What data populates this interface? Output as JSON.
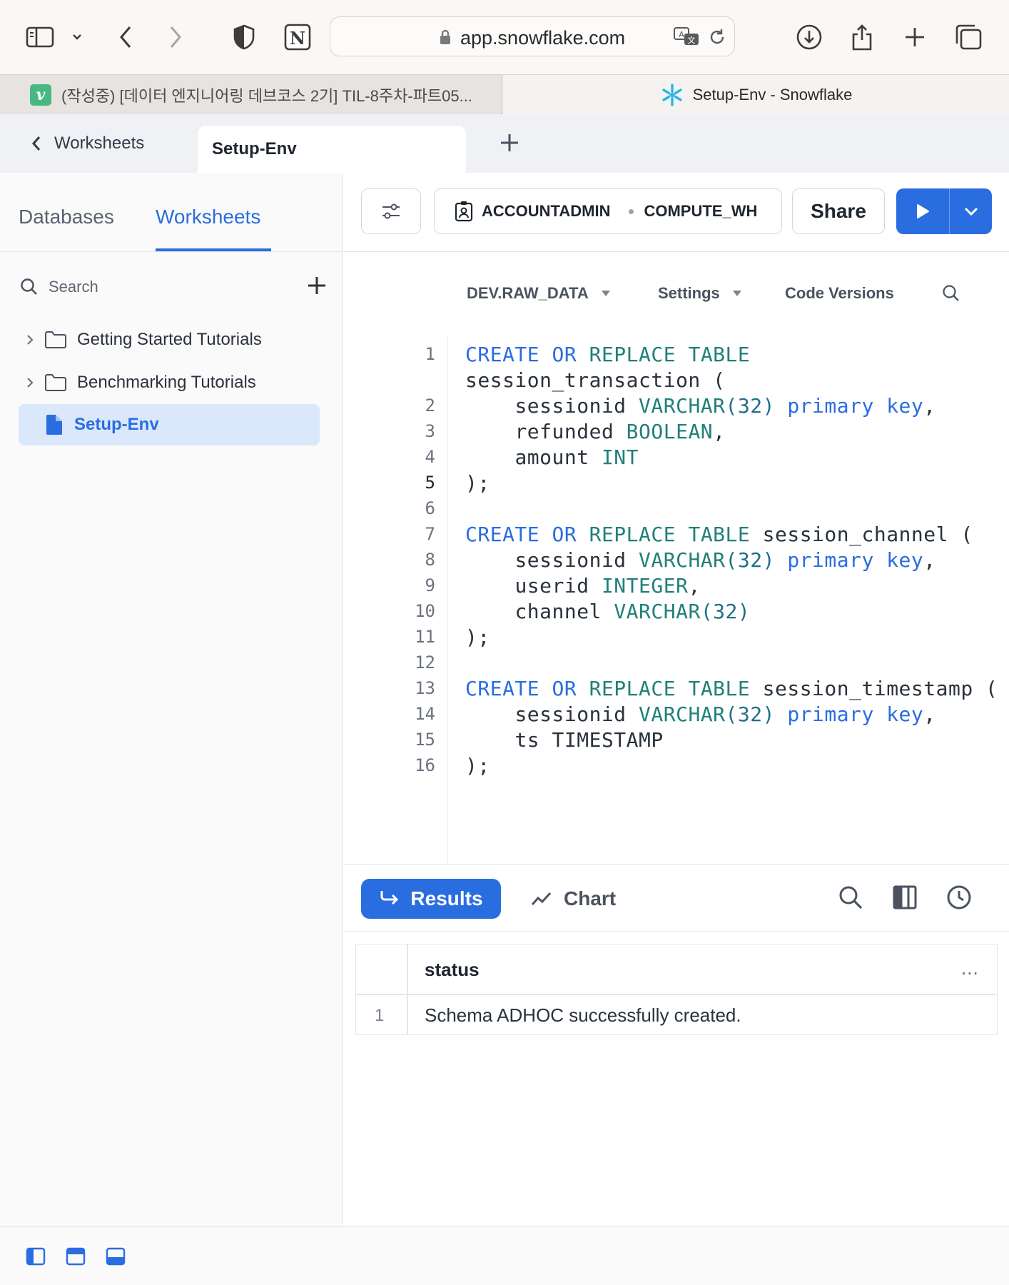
{
  "browser": {
    "url": "app.snowflake.com",
    "tabs": [
      {
        "title": "(작성중) [데이터 엔지니어링 데브코스 2기] TIL-8주차-파트05...",
        "favicon": "v",
        "favicon_color": "#47b881",
        "active": false
      },
      {
        "title": "Setup-Env - Snowflake",
        "favicon": "snowflake-icon",
        "favicon_color": "#29b5e8",
        "active": true
      }
    ]
  },
  "worksheet_tabs": {
    "back_label": "Worksheets",
    "active_tab": "Setup-Env"
  },
  "sidebar": {
    "tabs": [
      {
        "label": "Databases",
        "active": false
      },
      {
        "label": "Worksheets",
        "active": true
      }
    ],
    "search_placeholder": "Search",
    "items": [
      {
        "label": "Getting Started Tutorials",
        "type": "folder"
      },
      {
        "label": "Benchmarking Tutorials",
        "type": "folder"
      },
      {
        "label": "Setup-Env",
        "type": "worksheet",
        "selected": true
      }
    ]
  },
  "toolbar": {
    "role": "ACCOUNTADMIN",
    "warehouse": "COMPUTE_WH",
    "share_label": "Share",
    "run_color": "#2a6de0"
  },
  "editor_bar": {
    "context": "DEV.RAW_DATA",
    "settings": "Settings",
    "code_versions": "Code Versions"
  },
  "code": {
    "line_numbers": [
      "1",
      "2",
      "3",
      "4",
      "5",
      "6",
      "7",
      "8",
      "9",
      "10",
      "11",
      "12",
      "13",
      "14",
      "15",
      "16"
    ],
    "current_line": "5",
    "tokens": {
      "create": "CREATE",
      "or": "OR",
      "replace": "REPLACE",
      "table": "TABLE",
      "t1": "session_transaction (",
      "sessionid": "sessionid",
      "varchar": "VARCHAR",
      "n32": "(32)",
      "primary": "primary",
      "key": "key",
      "comma": ",",
      "refunded": "refunded",
      "boolean": "BOOLEAN",
      "amount": "amount",
      "int": "INT",
      "close": ");",
      "t2": "session_channel (",
      "userid": "userid",
      "integer": "INTEGER",
      "channel": "channel",
      "t3": "session_timestamp (",
      "ts_line": "ts TIMESTAMP"
    }
  },
  "results": {
    "results_label": "Results",
    "chart_label": "Chart",
    "column": "status",
    "more": "...",
    "rows": [
      {
        "num": "1",
        "status": "Schema ADHOC successfully created."
      }
    ]
  }
}
